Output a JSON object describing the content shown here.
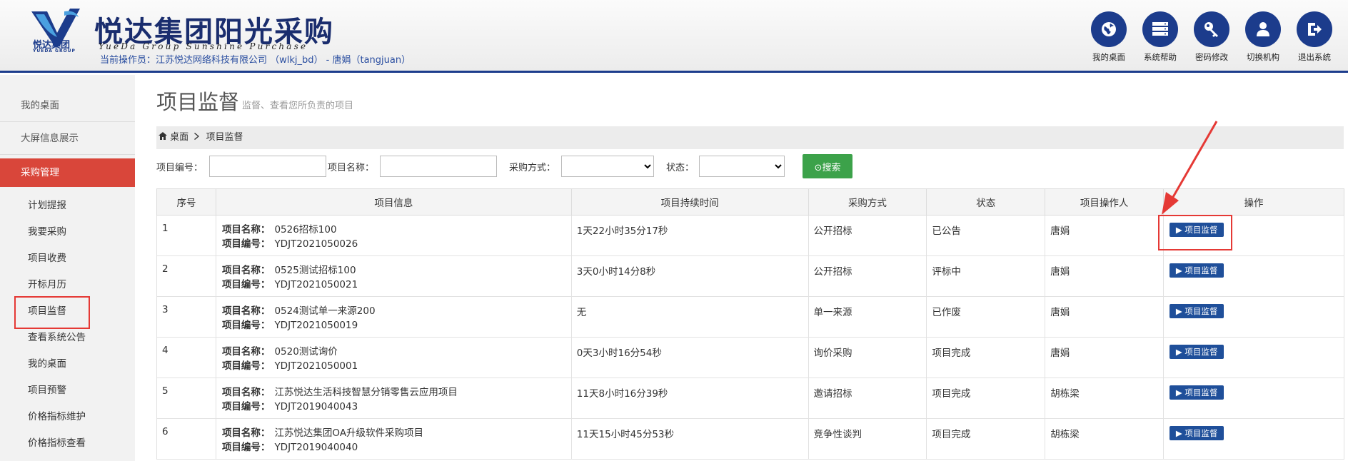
{
  "header": {
    "logo_text_cn": "悦达集团",
    "logo_text_en": "YUEDA GROUP",
    "title_cn": "悦达集团阳光采购",
    "title_en": "YueDa Group Sunshine Purchase",
    "operator": "当前操作员：江苏悦达网络科技有限公司 （wlkj_bd） - 唐娟（tangjuan）",
    "buttons": [
      {
        "label": "我的桌面",
        "icon": "globe-icon"
      },
      {
        "label": "系统帮助",
        "icon": "server-icon"
      },
      {
        "label": "密码修改",
        "icon": "key-icon"
      },
      {
        "label": "切换机构",
        "icon": "user-icon"
      },
      {
        "label": "退出系统",
        "icon": "logout-icon"
      }
    ]
  },
  "sidebar": {
    "top_items": [
      "我的桌面",
      "大屏信息展示"
    ],
    "active_section": "采购管理",
    "sub_items": [
      "计划提报",
      "我要采购",
      "项目收费",
      "开标月历",
      "项目监督",
      "查看系统公告",
      "我的桌面",
      "项目预警",
      "价格指标维护",
      "价格指标查看"
    ]
  },
  "main": {
    "title": "项目监督",
    "subtitle": "监督、查看您所负责的项目",
    "breadcrumb": {
      "home": "桌面",
      "current": "项目监督"
    },
    "search": {
      "project_no_label": "项目编号：",
      "project_name_label": "项目名称：",
      "method_label": "采购方式：",
      "status_label": "状态：",
      "button_label": "⊙搜索"
    },
    "table": {
      "headers": [
        "序号",
        "项目信息",
        "项目持续时间",
        "采购方式",
        "状态",
        "项目操作人",
        "操作"
      ],
      "name_label": "项目名称：",
      "code_label": "项目编号：",
      "action_label": "▶ 项目监督",
      "rows": [
        {
          "no": "1",
          "name": "0526招标100",
          "code": "YDJT2021050026",
          "duration": "1天22小时35分17秒",
          "method": "公开招标",
          "status": "已公告",
          "operator": "唐娟"
        },
        {
          "no": "2",
          "name": "0525测试招标100",
          "code": "YDJT2021050021",
          "duration": "3天0小时14分8秒",
          "method": "公开招标",
          "status": "评标中",
          "operator": "唐娟"
        },
        {
          "no": "3",
          "name": "0524测试单一来源200",
          "code": "YDJT2021050019",
          "duration": "无",
          "method": "单一来源",
          "status": "已作废",
          "operator": "唐娟"
        },
        {
          "no": "4",
          "name": "0520测试询价",
          "code": "YDJT2021050001",
          "duration": "0天3小时16分54秒",
          "method": "询价采购",
          "status": "项目完成",
          "operator": "唐娟"
        },
        {
          "no": "5",
          "name": "江苏悦达生活科技智慧分销零售云应用项目",
          "code": "YDJT2019040043",
          "duration": "11天8小时16分39秒",
          "method": "邀请招标",
          "status": "项目完成",
          "operator": "胡栋梁"
        },
        {
          "no": "6",
          "name": "江苏悦达集团OA升级软件采购项目",
          "code": "YDJT2019040040",
          "duration": "11天15小时45分53秒",
          "method": "竞争性谈判",
          "status": "项目完成",
          "operator": "胡栋梁"
        }
      ]
    }
  },
  "colors": {
    "brand": "#1c3c8c",
    "active": "#d9463a",
    "search": "#3ca24a",
    "action": "#1f4f9a",
    "highlight": "#e53935"
  }
}
